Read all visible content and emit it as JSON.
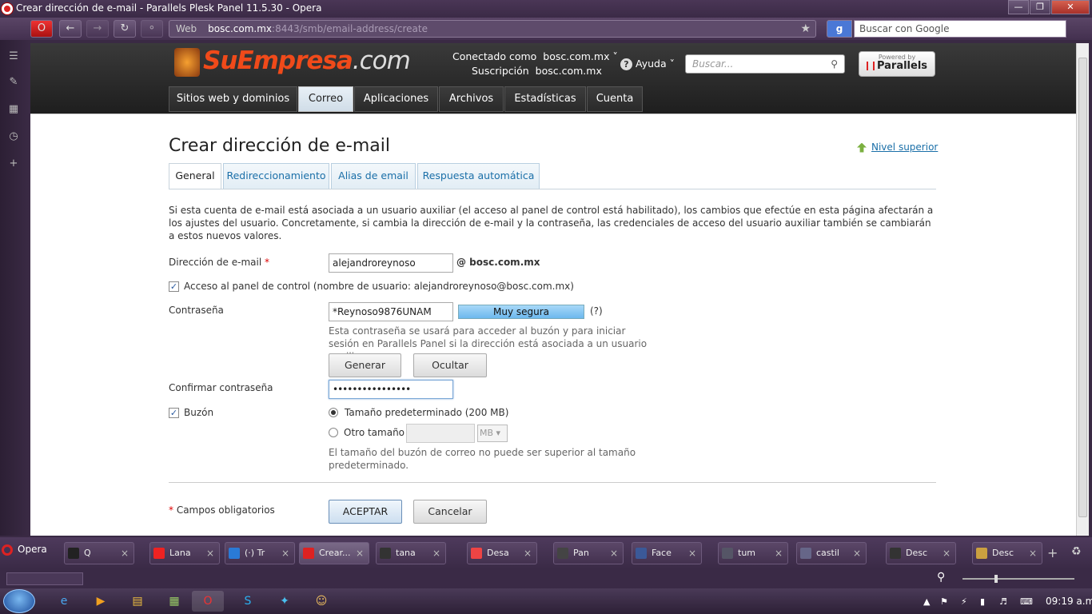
{
  "window": {
    "title": "Crear dirección de e-mail - Parallels Plesk Panel 11.5.30 - Opera"
  },
  "navbar": {
    "address_prefix": "Web",
    "address_host": "bosc.com.mx",
    "address_rest": ":8443/smb/email-address/create",
    "search_placeholder": "Buscar con Google"
  },
  "plesk_header": {
    "logo_main": "SuEmpresa",
    "logo_suffix": ".com",
    "connected_label": "Conectado como",
    "connected_value": "bosc.com.mx",
    "subscription_label": "Suscripción",
    "subscription_value": "bosc.com.mx",
    "help_label": "Ayuda",
    "search_placeholder": "Buscar...",
    "parallels_powered": "Powered by",
    "parallels_name": "Parallels"
  },
  "main_tabs": [
    {
      "label": "Sitios web y dominios"
    },
    {
      "label": "Correo"
    },
    {
      "label": "Aplicaciones"
    },
    {
      "label": "Archivos"
    },
    {
      "label": "Estadísticas"
    },
    {
      "label": "Cuenta"
    }
  ],
  "page": {
    "title": "Crear dirección de e-mail",
    "up_level": "Nivel superior",
    "sub_tabs": [
      {
        "label": "General"
      },
      {
        "label": "Redireccionamiento"
      },
      {
        "label": "Alias de email"
      },
      {
        "label": "Respuesta automática"
      }
    ],
    "intro": "Si esta cuenta de e-mail está asociada a un usuario auxiliar (el acceso al panel de control está habilitado), los cambios que efectúe en esta página afectarán a los ajustes del usuario. Concretamente, si cambia la dirección de e-mail y la contraseña, las credenciales de acceso del usuario auxiliar también se cambiarán a estos nuevos valores."
  },
  "form": {
    "email_label": "Dirección de e-mail",
    "required_mark": "*",
    "email_value": "alejandroreynoso",
    "email_domain": "@ bosc.com.mx",
    "panel_access_checked": true,
    "panel_access_label": "Acceso al panel de control (nombre de usuario: alejandroreynoso@bosc.com.mx)",
    "password_label": "Contraseña",
    "password_value": "*Reynoso9876UNAM",
    "strength_label": "Muy segura",
    "strength_help": "(?)",
    "password_hint": "Esta contraseña se usará para acceder al buzón y para iniciar sesión en Parallels Panel si la dirección está asociada a un usuario auxiliar.",
    "generate_button": "Generar",
    "hide_button": "Ocultar",
    "confirm_label": "Confirmar contraseña",
    "confirm_value": "••••••••••••••••",
    "mailbox_checked": true,
    "mailbox_label": "Buzón",
    "size_default_label": "Tamaño predeterminado (200 MB)",
    "size_other_label": "Otro tamaño",
    "size_unit": "MB",
    "size_hint": "El tamaño del buzón de correo no puede ser superior al tamaño predeterminado.",
    "required_note": "Campos obligatorios",
    "ok_button": "ACEPTAR",
    "cancel_button": "Cancelar"
  },
  "tab_strip": {
    "opera_label": "Opera",
    "tabs": [
      {
        "label": "Q",
        "icon": "h-icon",
        "color": "#222"
      },
      {
        "label": "Lana",
        "icon": "youtube-icon",
        "color": "#e22"
      },
      {
        "label": "(·) Tr",
        "icon": "trello-icon",
        "color": "#2a7ad6"
      },
      {
        "label": "Crear...",
        "icon": "plesk-icon",
        "color": "#d22"
      },
      {
        "label": "tana",
        "icon": "github-icon",
        "color": "#333"
      },
      {
        "label": "Desa",
        "icon": "md-icon",
        "color": "#e44"
      },
      {
        "label": "Pan",
        "icon": "dots-icon",
        "color": "#444"
      },
      {
        "label": "Face",
        "icon": "facebook-icon",
        "color": "#3b5998"
      },
      {
        "label": "tum",
        "icon": "tumblr-icon",
        "color": "#556"
      },
      {
        "label": "castil",
        "icon": "image-icon",
        "color": "#668"
      },
      {
        "label": "Desc",
        "icon": "download-icon",
        "color": "#333"
      },
      {
        "label": "Desc",
        "icon": "download-icon",
        "color": "#caa040"
      }
    ]
  },
  "taskbar": {
    "clock": "09:19 a.m."
  }
}
